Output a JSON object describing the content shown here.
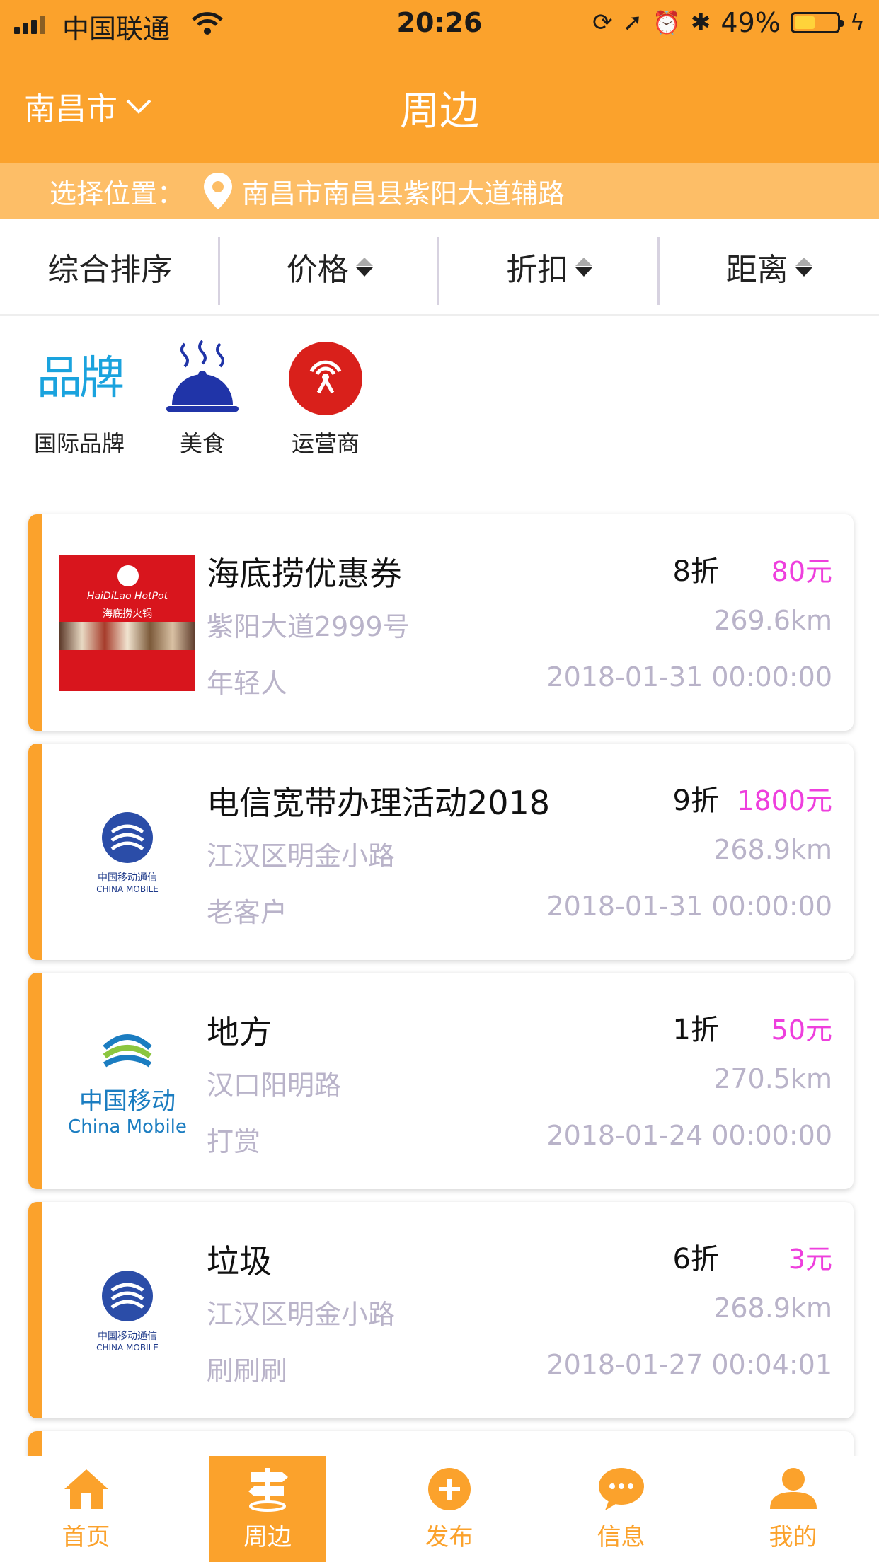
{
  "status_bar": {
    "carrier": "中国联通",
    "time": "20:26",
    "battery": "49%",
    "battery_level": 0.49
  },
  "header": {
    "city": "南昌市",
    "title": "周边"
  },
  "location": {
    "label": "选择位置：",
    "address": "南昌市南昌县紫阳大道辅路"
  },
  "sort": {
    "items": [
      {
        "label": "综合排序"
      },
      {
        "label": "价格"
      },
      {
        "label": "折扣"
      },
      {
        "label": "距离"
      }
    ]
  },
  "categories": [
    {
      "label": "国际品牌",
      "icon_text": "品牌"
    },
    {
      "label": "美食",
      "icon": "cloche-icon"
    },
    {
      "label": "运营商",
      "icon": "signal-tower-icon"
    }
  ],
  "cards": [
    {
      "name": "海底捞优惠券",
      "discount": "8折",
      "price": "80元",
      "address": "紫阳大道2999号",
      "distance": "269.6km",
      "tag": "年轻人",
      "date": "2018-01-31 00:00:00",
      "logo": {
        "type": "hotpot",
        "text1": "HaiDiLao HotPot",
        "text2": "海底捞火锅"
      }
    },
    {
      "name": "电信宽带办理活动2018",
      "discount": "9折",
      "price": "1800元",
      "address": "江汉区明金小路",
      "distance": "268.9km",
      "tag": "老客户",
      "date": "2018-01-31 00:00:00",
      "logo": {
        "type": "china-mobile-small",
        "text1": "中国移动通信",
        "text2": "CHINA MOBILE"
      }
    },
    {
      "name": "地方",
      "discount": "1折",
      "price": "50元",
      "address": "汉口阳明路",
      "distance": "270.5km",
      "tag": "打赏",
      "date": "2018-01-24 00:00:00",
      "logo": {
        "type": "china-mobile-big",
        "text1": "中国移动",
        "text2": "China Mobile"
      }
    },
    {
      "name": "垃圾",
      "discount": "6折",
      "price": "3元",
      "address": "江汉区明金小路",
      "distance": "268.9km",
      "tag": "刷刷刷",
      "date": "2018-01-27 00:04:01",
      "logo": {
        "type": "china-mobile-small",
        "text1": "中国移动通信",
        "text2": "CHINA MOBILE"
      }
    }
  ],
  "tabbar": {
    "items": [
      {
        "label": "首页",
        "icon": "home-icon"
      },
      {
        "label": "周边",
        "icon": "signpost-icon",
        "active": true
      },
      {
        "label": "发布",
        "icon": "plus-icon"
      },
      {
        "label": "信息",
        "icon": "chat-icon"
      },
      {
        "label": "我的",
        "icon": "user-icon"
      }
    ]
  },
  "colors": {
    "brand": "#FBA22C",
    "location_bar": "#FDBE67",
    "price": "#EE3FDD",
    "muted": "#B9B3C9"
  }
}
